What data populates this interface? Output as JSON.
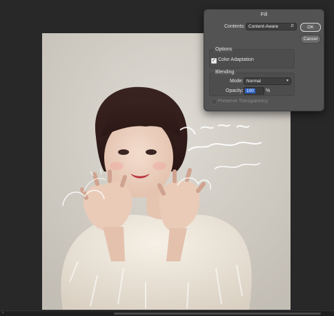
{
  "dialog": {
    "title": "Fill",
    "contents_label": "Contents:",
    "contents_value": "Content-Aware",
    "ok_label": "OK",
    "cancel_label": "Cancel",
    "options_header": "Options",
    "color_adaptation_label": "Color Adaptation",
    "color_adaptation_checked": true,
    "blending_header": "Blending",
    "mode_label": "Mode:",
    "mode_value": "Normal",
    "opacity_label": "Opacity:",
    "opacity_value": "100",
    "opacity_unit": "%",
    "preserve_transparency_label": "Preserve Transparency",
    "preserve_transparency_checked": false
  },
  "colors": {
    "app_background": "#272727",
    "dialog_background": "#535353",
    "selection_highlight": "#2f66c9"
  },
  "icons": {
    "contents_dropdown": "chevron-updown-icon",
    "mode_dropdown": "chevron-down-icon",
    "checkbox": "checkmark-icon",
    "scroll_left": "chevron-right-icon"
  }
}
